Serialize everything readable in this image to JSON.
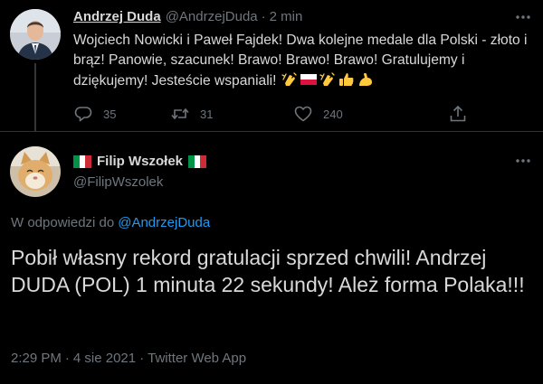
{
  "parent_tweet": {
    "author_name": "Andrzej Duda",
    "author_handle": "@AndrzejDuda",
    "separator": "·",
    "time": "2 min",
    "text": "Wojciech Nowicki i Paweł Fajdek! Dwa kolejne medale dla Polski - złoto i brąz! Panowie, szacunek! Brawo! Brawo! Brawo! Gratulujemy i dziękujemy! Jesteście wspaniali!",
    "emoji_icons": [
      "clapping-hands-icon",
      "poland-flag-icon",
      "clapping-hands-icon",
      "thumbs-up-icon",
      "flexed-biceps-icon"
    ],
    "actions": {
      "reply_count": "35",
      "retweet_count": "31",
      "like_count": "240"
    }
  },
  "reply_tweet": {
    "author_name": "Filip Wszołek",
    "author_handle": "@FilipWszolek",
    "name_flags": [
      "italy-flag-icon",
      "italy-flag-icon"
    ],
    "replying_to_prefix": "W odpowiedzi do",
    "replying_to_handle": "@AndrzejDuda",
    "text": "Pobił własny rekord gratulacji sprzed chwili! Andrzej DUDA (POL) 1 minuta 22 sekundy! Ależ forma Polaka!!!",
    "time": "2:29 PM",
    "date": "4 sie 2021",
    "source": "Twitter Web App",
    "separator": "·"
  },
  "colors": {
    "background": "#000000",
    "text": "#d9d9d9",
    "secondary_text": "#6e767d",
    "link": "#1d9bf0",
    "divider": "#2f3336"
  }
}
